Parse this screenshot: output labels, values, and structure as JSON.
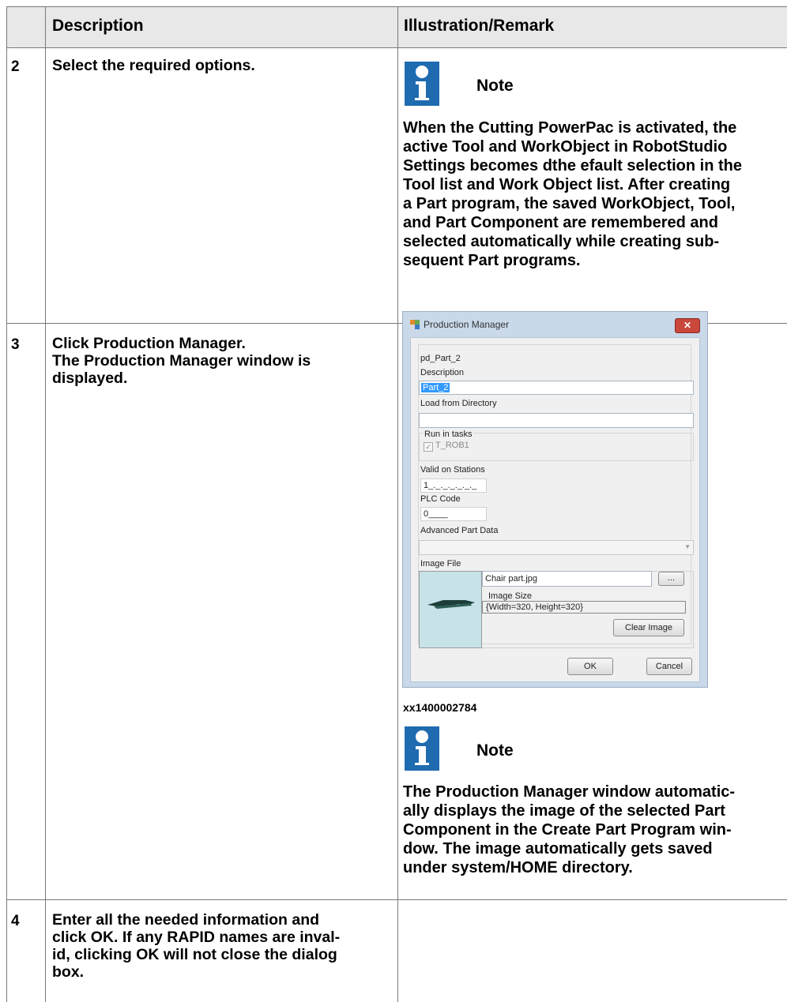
{
  "table": {
    "header": {
      "col_step": "",
      "col_description": "Description",
      "col_illustration": "Illustration/Remark"
    },
    "rows": [
      {
        "step": "2",
        "description": "Select the required options.",
        "note": {
          "label": "Note",
          "lines": [
            "When the Cutting PowerPac is activated, the",
            "active Tool and WorkObject in RobotStudio",
            "Settings becomes dthe efault selection in the",
            [
              "Tool",
              " list and ",
              "Work Object",
              " list. After creating"
            ],
            "a Part program, the saved WorkObject, Tool,",
            "and Part Component are remembered and",
            "selected automatically while creating sub-",
            "sequent Part programs."
          ]
        }
      },
      {
        "step": "3",
        "description_lines": [
          [
            "Click ",
            "Production Manager",
            "."
          ],
          [
            "The ",
            "Production Manager",
            " window is"
          ],
          [
            "displayed."
          ]
        ],
        "caption": "xx1400002784",
        "note": {
          "label": "Note",
          "lines": [
            [
              "The ",
              "Production Manager",
              " window automatic-"
            ],
            [
              "ally displays the image of the selected Part"
            ],
            [
              "Component in the ",
              "Create Part Program",
              " win-"
            ],
            [
              "dow. The image automatically gets saved"
            ],
            [
              "under system/HOME directory."
            ]
          ]
        }
      },
      {
        "step": "4",
        "description_lines": [
          [
            "Enter all the needed information and"
          ],
          [
            "click ",
            "OK",
            ". If any RAPID names are inval-"
          ],
          [
            "id, clicking ",
            "OK",
            " will not close the dialog"
          ],
          [
            "box."
          ]
        ]
      }
    ]
  },
  "dialog": {
    "title": "Production Manager",
    "close_glyph": "✕",
    "name": "pd_Part_2",
    "description_label": "Description",
    "description_value": "Part_2",
    "load_label": "Load from Directory",
    "load_value": "",
    "run_tasks_label": "Run in tasks",
    "task_name": "T_ROB1",
    "valid_label": "Valid on Stations",
    "valid_value": "1_._._._._._._",
    "plc_label": "PLC Code",
    "plc_value": "0____",
    "advanced_label": "Advanced Part Data",
    "image_label": "Image File",
    "image_file": "Chair part.jpg",
    "browse_label": "...",
    "image_size_label": "Image Size",
    "image_size_value": "{Width=320, Height=320}",
    "clear_label": "Clear Image",
    "ok_label": "OK",
    "cancel_label": "Cancel"
  }
}
